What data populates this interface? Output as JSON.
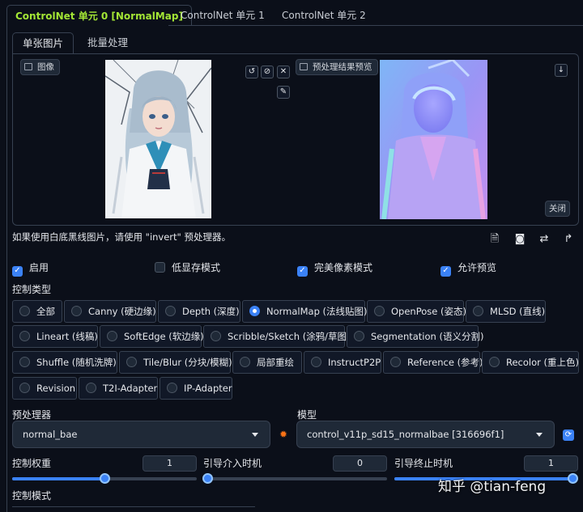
{
  "tabs": {
    "unit0": "ControlNet 单元 0 [NormalMap]",
    "unit1": "ControlNet 单元 1",
    "unit2": "ControlNet 单元 2"
  },
  "subtabs": {
    "single": "单张图片",
    "batch": "批量处理"
  },
  "image_panel": {
    "input_label": "图像",
    "preview_label": "预处理结果预览",
    "close_label": "关闭",
    "input_image": "anime-girl-illustration",
    "preview_image": "normal-map-preview"
  },
  "hint": "如果使用白底黑线图片，请使用 \"invert\" 预处理器。",
  "options": {
    "enable": "启用",
    "low_vram": "低显存模式",
    "pixel_perfect": "完美像素模式",
    "allow_preview": "允许预览",
    "states": {
      "enable": true,
      "low_vram": false,
      "pixel_perfect": true,
      "allow_preview": true
    }
  },
  "control_type": {
    "label": "控制类型",
    "selected": "NormalMap (法线贴图)",
    "items": [
      "全部",
      "Canny (硬边缘)",
      "Depth (深度)",
      "NormalMap (法线贴图)",
      "OpenPose (姿态)",
      "MLSD (直线)",
      "Lineart (线稿)",
      "SoftEdge (软边缘)",
      "Scribble/Sketch (涂鸦/草图)",
      "Segmentation (语义分割)",
      "Shuffle (随机洗牌)",
      "Tile/Blur (分块/模糊)",
      "局部重绘",
      "InstructP2P",
      "Reference (参考)",
      "Recolor (重上色)",
      "Revision",
      "T2I-Adapter",
      "IP-Adapter"
    ]
  },
  "preprocessor": {
    "label": "预处理器",
    "value": "normal_bae"
  },
  "model": {
    "label": "模型",
    "value": "control_v11p_sd15_normalbae [316696f1]"
  },
  "sliders": {
    "weight": {
      "label": "控制权重",
      "value": "1",
      "fraction": 0.5
    },
    "start": {
      "label": "引导介入时机",
      "value": "0",
      "fraction": 0
    },
    "end": {
      "label": "引导终止时机",
      "value": "1",
      "fraction": 1
    }
  },
  "control_mode": {
    "label": "控制模式"
  },
  "watermark": "知乎 @tian-feng",
  "colors": {
    "accent": "#3b82f6",
    "active_tab": "#a3e635",
    "bg": "#0b0f19"
  }
}
